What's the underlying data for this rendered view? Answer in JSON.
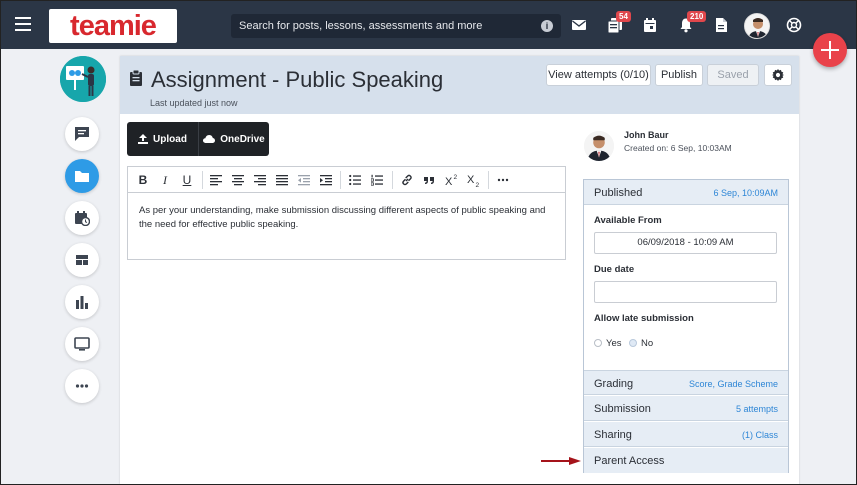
{
  "topbar": {
    "logo_text": "teamie",
    "search_placeholder": "Search for posts, lessons, assessments and more",
    "info_icon": "i",
    "badges": {
      "updates": "54",
      "notifications": "210"
    },
    "icons": [
      "menu-icon",
      "mail-icon",
      "updates-icon",
      "calendar-icon",
      "bell-icon",
      "documents-icon",
      "avatar",
      "help-icon"
    ]
  },
  "sidebar": {
    "items": [
      "discussions-icon",
      "folder-icon",
      "calendar-clock-icon",
      "dashboard-icon",
      "analytics-icon",
      "monitor-icon",
      "more-icon"
    ]
  },
  "assignment": {
    "title": "Assignment - Public Speaking",
    "last_updated": "Last updated just now",
    "view_attempts": "View attempts (0/10)",
    "publish": "Publish",
    "saved": "Saved"
  },
  "upload": {
    "upload_label": "Upload",
    "onedrive_label": "OneDrive"
  },
  "editor": {
    "tools": [
      "B",
      "I",
      "U"
    ],
    "body": "As per your understanding, make submission discussing different aspects of public speaking and the need for effective public speaking."
  },
  "author": {
    "name": "John Baur",
    "created": "Created on: 6 Sep, 10:03AM"
  },
  "panel": {
    "status_label": "Published",
    "status_value": "6 Sep, 10:09AM",
    "available_from_label": "Available From",
    "available_from_value": "06/09/2018 - 10:09 AM",
    "due_date_label": "Due date",
    "due_date_value": "",
    "late_label": "Allow late submission",
    "late_yes": "Yes",
    "late_no": "No",
    "sections": [
      {
        "label": "Grading",
        "value": "Score, Grade Scheme"
      },
      {
        "label": "Submission",
        "value": "5 attempts"
      },
      {
        "label": "Sharing",
        "value": "(1) Class"
      },
      {
        "label": "Parent Access",
        "value": ""
      }
    ]
  },
  "colors": {
    "topbar": "#2b3646",
    "accent": "#2e9be6",
    "link": "#2e86d6",
    "fab": "#e9424a",
    "arrow": "#a5131a"
  }
}
